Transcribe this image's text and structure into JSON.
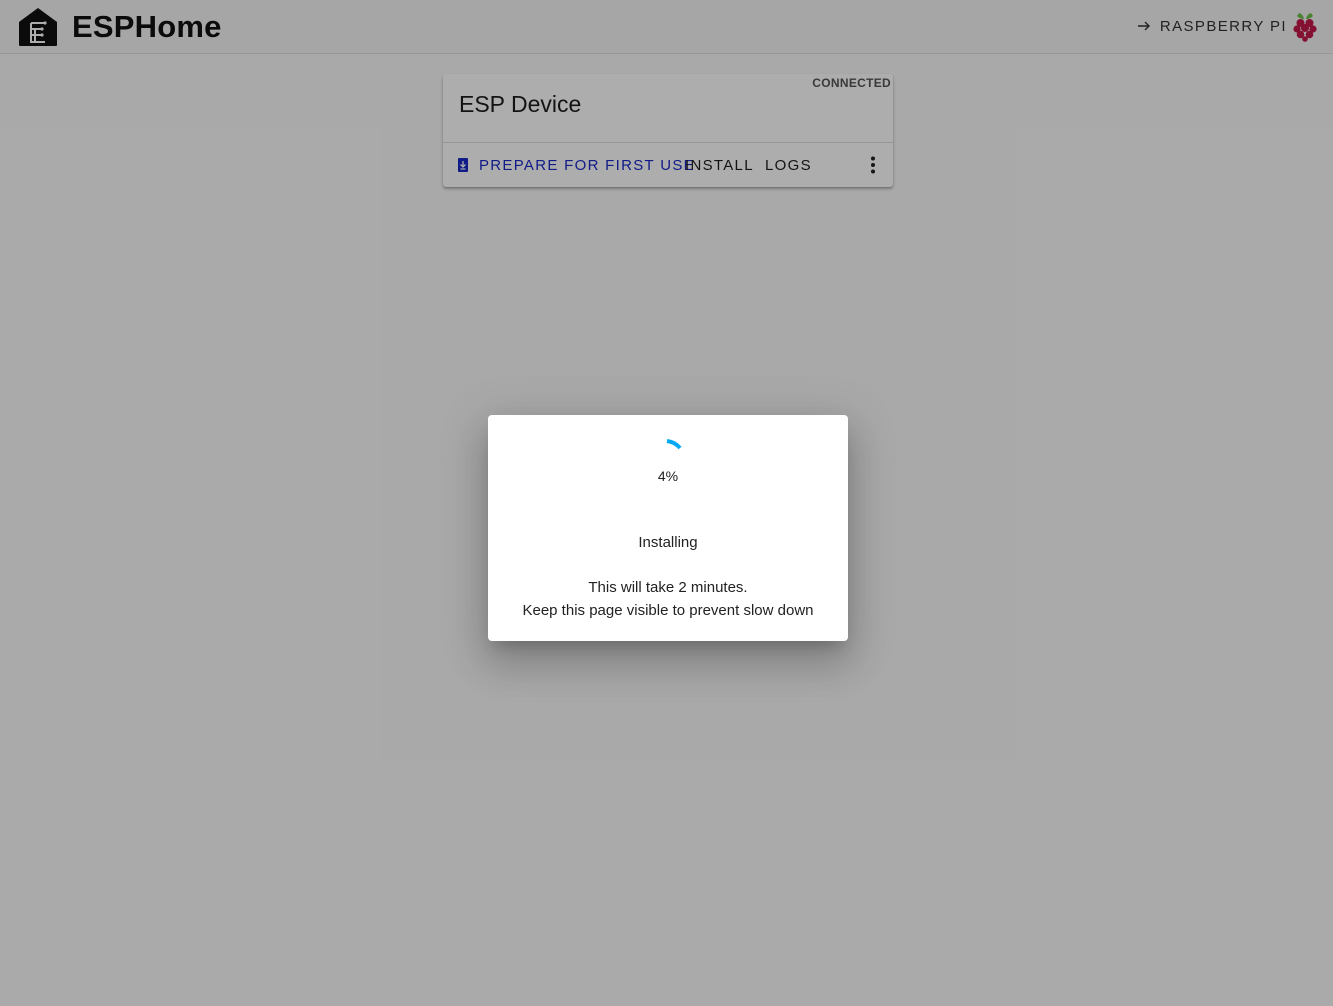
{
  "header": {
    "brand_name": "ESPHome",
    "host_label": "RASPBERRY PI",
    "logo_icon": "esphome-house-icon",
    "host_icon": "raspberry-pi-icon",
    "arrow_icon": "arrow-right-icon"
  },
  "device_card": {
    "title": "ESP Device",
    "status": "CONNECTED",
    "actions": {
      "prepare_label": "PREPARE FOR FIRST USE",
      "install_label": "INSTALL",
      "logs_label": "LOGS"
    },
    "prepare_icon": "device-install-icon",
    "menu_icon": "more-vertical-icon"
  },
  "dialog": {
    "progress_text": "4%",
    "progress_percent": 4,
    "status": "Installing",
    "info_line1": "This will take 2 minutes.",
    "info_line2": "Keep this page visible to prevent slow down"
  },
  "colors": {
    "accent": "#1a28c7",
    "spinner": "#03a9f4",
    "raspberry": "#c51a4a",
    "leaf": "#6cc04a"
  }
}
